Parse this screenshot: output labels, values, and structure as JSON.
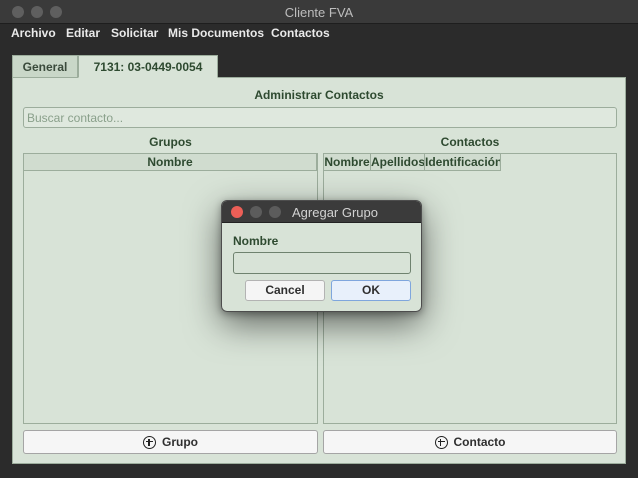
{
  "window": {
    "title": "Cliente FVA"
  },
  "menu": [
    "Archivo",
    "Editar",
    "Solicitar",
    "Mis Documentos",
    "Contactos"
  ],
  "tabs": [
    {
      "label": "General",
      "active": false
    },
    {
      "label": "7131: 03-0449-0054",
      "active": true
    }
  ],
  "main": {
    "title": "Administrar Contactos",
    "search_placeholder": "Buscar contacto...",
    "groups": {
      "label": "Grupos",
      "columns": [
        "Nombre"
      ],
      "add_button_label": "Grupo"
    },
    "contacts": {
      "label": "Contactos",
      "columns": [
        "Nombre",
        "Apellidos",
        "Identificación"
      ],
      "add_button_label": "Contacto"
    }
  },
  "dialog": {
    "title": "Agregar Grupo",
    "field_label": "Nombre",
    "field_value": "",
    "cancel_label": "Cancel",
    "ok_label": "OK"
  },
  "colors": {
    "panel_bg": "#d8e3d7",
    "label_green": "#2e4a30",
    "close_red": "#ec5f57",
    "ok_border_blue": "#7fa6dd"
  },
  "icons": [
    "plus-circle-icon",
    "plus-circle-icon"
  ]
}
